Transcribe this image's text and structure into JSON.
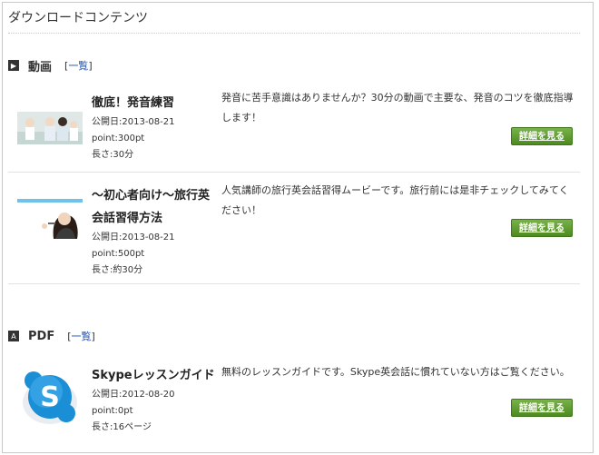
{
  "page": {
    "title": "ダウンロードコンテンツ"
  },
  "sections": [
    {
      "title": "動画",
      "list_link_open": "[",
      "list_link": "一覧",
      "list_link_close": "]",
      "items": [
        {
          "title": "徹底！発音練習",
          "date": "公開日:2013-08-21",
          "point": "point:300pt",
          "length": "長さ:30分",
          "description": "発音に苦手意識はありませんか？30分の動画で主要な、発音のコツを徹底指導します！",
          "button": "詳細を見る"
        },
        {
          "title": "～初心者向け～旅行英会話習得方法",
          "date": "公開日:2013-08-21",
          "point": "point:500pt",
          "length": "長さ:約30分",
          "description": "人気講師の旅行英会話習得ムービーです。旅行前には是非チェックしてみてください！",
          "button": "詳細を見る"
        }
      ]
    },
    {
      "title": "PDF",
      "list_link_open": "[",
      "list_link": "一覧",
      "list_link_close": "]",
      "items": [
        {
          "title": "Skypeレッスンガイド",
          "date": "公開日:2012-08-20",
          "point": "point:0pt",
          "length": "長さ:16ページ",
          "description": "無料のレッスンガイドです。Skype英会話に慣れていない方はご覧ください。",
          "button": "詳細を見る"
        }
      ]
    }
  ],
  "colors": {
    "button": "#5a9a28",
    "link": "#1a4fb0"
  }
}
